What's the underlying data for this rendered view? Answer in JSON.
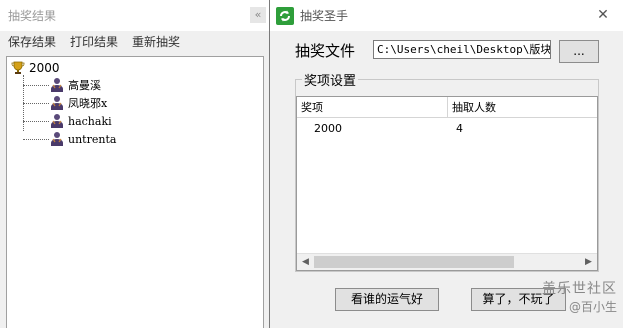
{
  "results_window": {
    "title": "抽奖结果",
    "minimize_glyph": "«",
    "menu": [
      "保存结果",
      "打印结果",
      "重新抽奖"
    ],
    "tree": {
      "root": "2000",
      "winners": [
        "高曼溪",
        "凤晓邪x",
        "hachaki",
        "untrenta"
      ]
    }
  },
  "lottery_window": {
    "title": "抽奖圣手",
    "close_glyph": "✕",
    "file_label": "抽奖文件",
    "file_path": "C:\\Users\\cheil\\Desktop\\版块活",
    "browse_label": "...",
    "group_title": "奖项设置",
    "columns": [
      "奖项",
      "抽取人数"
    ],
    "rows": [
      {
        "prize": "2000",
        "count": "4"
      }
    ],
    "lucky_button": "看谁的运气好",
    "quit_button": "算了，不玩了"
  },
  "watermark": {
    "line1": "盖乐世社区",
    "line2": "@百小生"
  },
  "colors": {
    "window_bg": "#f0f0f0",
    "titlebar_bg": "#ffffff",
    "icon_green": "#2e9e3a"
  }
}
